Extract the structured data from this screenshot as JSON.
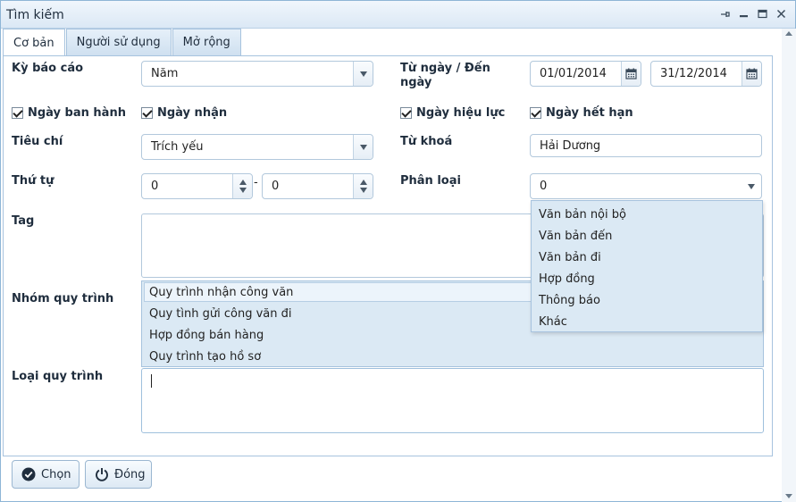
{
  "window": {
    "title": "Tìm kiếm"
  },
  "tabs": [
    {
      "label": "Cơ bản"
    },
    {
      "label": "Người sử dụng"
    },
    {
      "label": "Mở rộng"
    }
  ],
  "form": {
    "report_period": {
      "label": "Kỳ báo cáo",
      "value": "Năm"
    },
    "date_range": {
      "label": "Từ ngày / Đến ngày",
      "from": "01/01/2014",
      "to": "31/12/2014"
    },
    "checkboxes": [
      {
        "label": "Ngày ban hành",
        "checked": true
      },
      {
        "label": "Ngày nhận",
        "checked": true
      },
      {
        "label": "Ngày hiệu lực",
        "checked": true
      },
      {
        "label": "Ngày hết hạn",
        "checked": true
      }
    ],
    "criteria": {
      "label": "Tiêu chí",
      "value": "Trích yếu"
    },
    "keyword": {
      "label": "Từ khoá",
      "value": "Hải Dương"
    },
    "order": {
      "label": "Thứ tự",
      "from": "0",
      "separator": "-",
      "to": "0"
    },
    "classification": {
      "label": "Phân loại",
      "value": "0",
      "options": [
        "Văn bản nội bộ",
        "Văn bản đến",
        "Văn bản đi",
        "Hợp đồng",
        "Thông báo",
        "Khác"
      ]
    },
    "tag": {
      "label": "Tag"
    },
    "process_group": {
      "label": "Nhóm quy trình",
      "options": [
        "Quy trình nhận công văn",
        "Quy tình gửi công văn đi",
        "Hợp đồng bán hàng",
        "Quy trình tạo hồ sơ"
      ]
    },
    "process_type": {
      "label": "Loại quy trình"
    }
  },
  "buttons": {
    "choose": "Chọn",
    "close": "Đóng"
  },
  "colors": {
    "accent": "#a7c3de",
    "title_bg": "#dbe8f5"
  }
}
